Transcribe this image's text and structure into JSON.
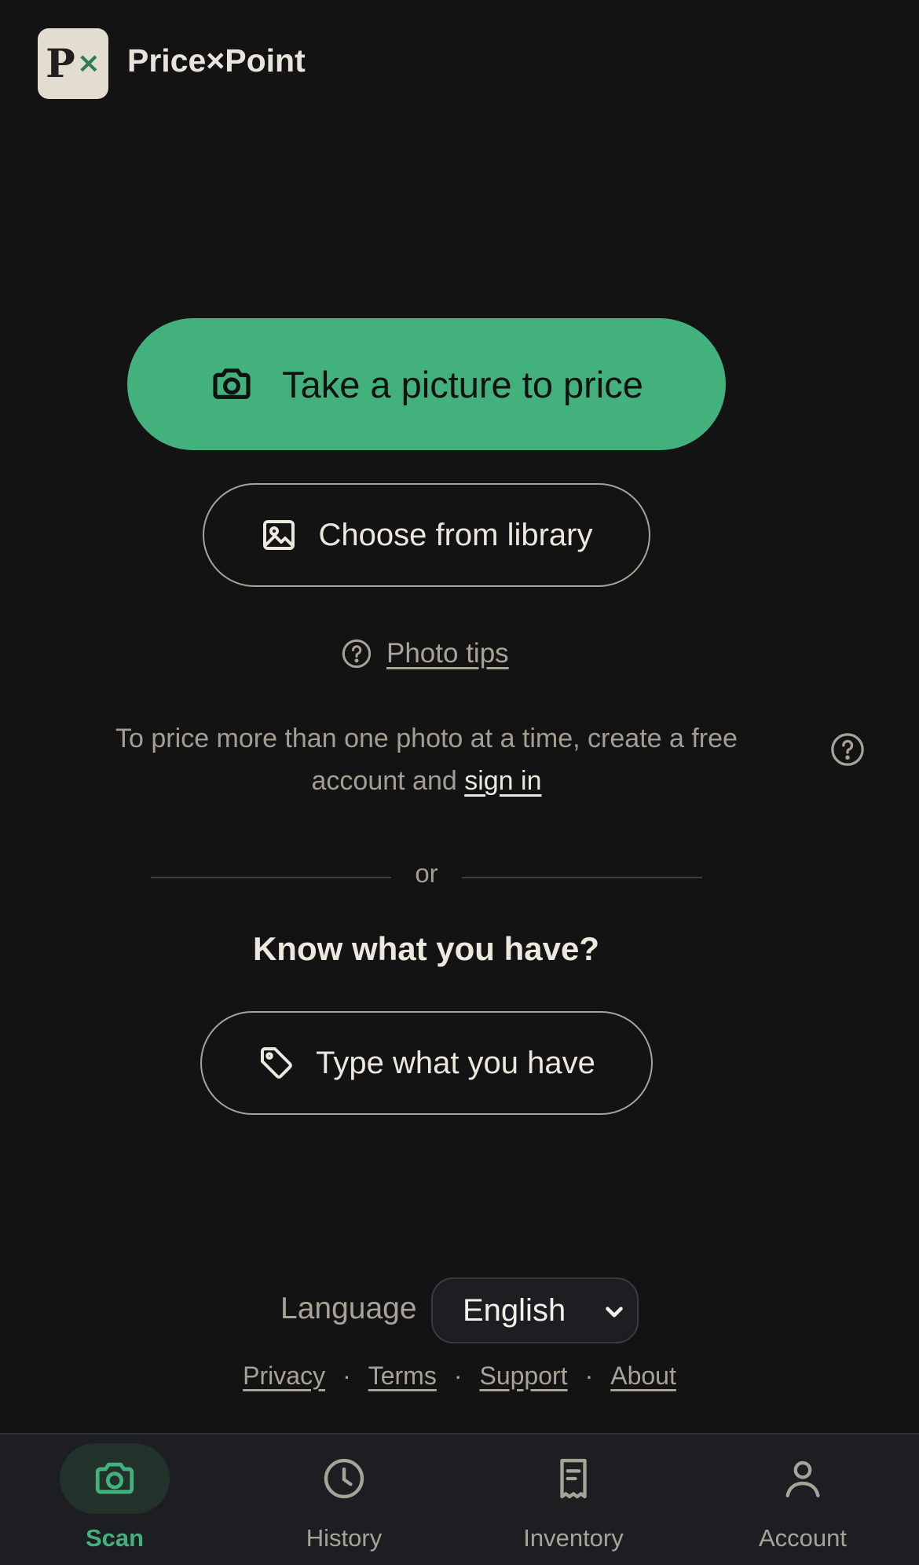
{
  "app": {
    "logo_letter": "P",
    "logo_mark": "×",
    "title": "Price×Point"
  },
  "actions": {
    "take_picture_label": "Take a picture to price",
    "take_picture_icon": "camera-icon",
    "library_label": "Choose from library",
    "library_icon": "image-icon",
    "photo_tips_label": "Photo tips",
    "photo_tips_icon": "question-circle-icon"
  },
  "signin_prompt": {
    "text_before": "To price more than one photo at a time, create a free account and",
    "link_label": "sign in",
    "help_icon": "question-circle-icon"
  },
  "divider": {
    "label": "or"
  },
  "manual": {
    "heading": "Know what you have?",
    "type_label": "Type what you have",
    "type_icon": "tag-icon"
  },
  "language": {
    "label": "Language",
    "selected": "English"
  },
  "footer": {
    "links": [
      "Privacy",
      "Terms",
      "Support",
      "About"
    ],
    "separator": "·"
  },
  "nav": {
    "active": "Scan",
    "items": [
      {
        "label": "Scan",
        "icon": "camera-icon"
      },
      {
        "label": "History",
        "icon": "clock-icon"
      },
      {
        "label": "Inventory",
        "icon": "receipt-icon"
      },
      {
        "label": "Account",
        "icon": "user-icon"
      }
    ]
  },
  "colors": {
    "background": "#131313",
    "accent": "#42b17c",
    "nav_background": "#1d1e22",
    "muted_text": "#a8a397"
  }
}
